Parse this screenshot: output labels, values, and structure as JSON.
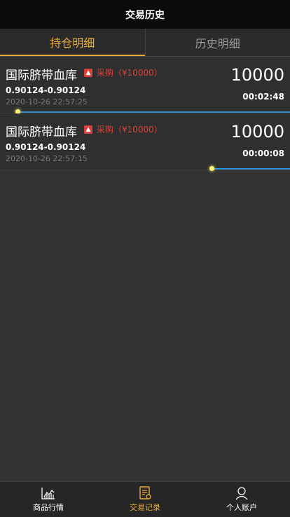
{
  "header": {
    "title": "交易历史"
  },
  "tabs": [
    {
      "label": "持仓明细",
      "active": true
    },
    {
      "label": "历史明细",
      "active": false
    }
  ],
  "items": [
    {
      "name": "国际脐带血库",
      "type_label": "采购（¥10000）",
      "range": "0.90124-0.90124",
      "time": "2020-10-26 22:57:25",
      "amount": "10000",
      "timer": "00:02:48",
      "progress_fraction": 0.94
    },
    {
      "name": "国际脐带血库",
      "type_label": "采购（¥10000）",
      "range": "0.90124-0.90124",
      "time": "2020-10-26 22:57:15",
      "amount": "10000",
      "timer": "00:00:08",
      "progress_fraction": 0.27
    }
  ],
  "tabbar": [
    {
      "label": "商品行情",
      "icon": "chart-icon",
      "active": false
    },
    {
      "label": "交易记录",
      "icon": "document-icon",
      "active": true
    },
    {
      "label": "个人账户",
      "icon": "user-icon",
      "active": false
    }
  ],
  "colors": {
    "accent": "#e9ac3a",
    "buy": "#d8413a",
    "progress": "#2f8fd6",
    "dot": "#fff176"
  }
}
